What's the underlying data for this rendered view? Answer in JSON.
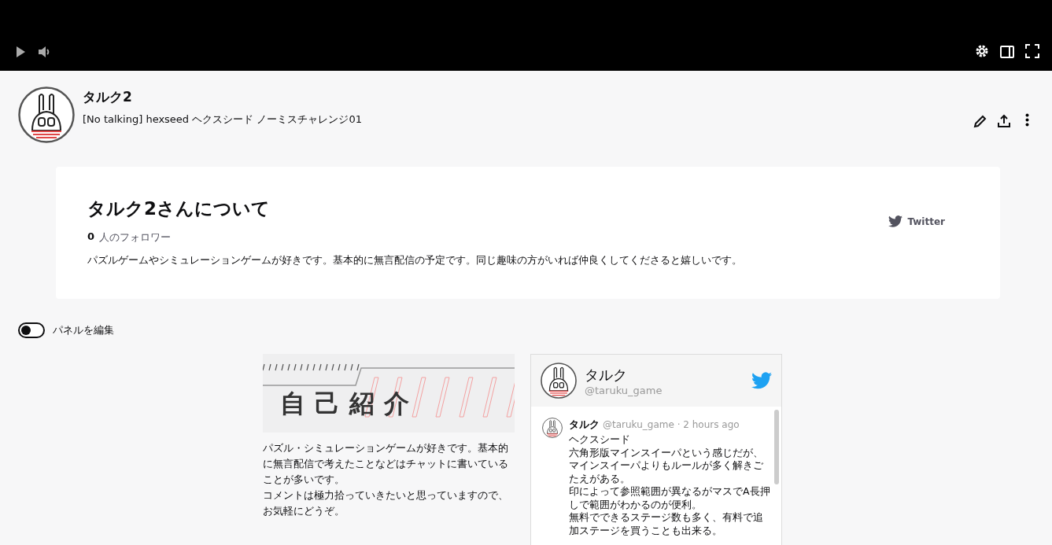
{
  "channel": {
    "name": "タルク2",
    "stream_title": "[No talking] hexseed ヘクスシード ノーミスチャレンジ01"
  },
  "about": {
    "title": "タルク2さんについて",
    "follower_count": "0",
    "follower_label": "人のフォロワー",
    "description": "パズルゲームやシミュレーションゲームが好きです。基本的に無言配信の予定です。同じ趣味の方がいれば仲良くしてくださると嬉しいです。",
    "social_link": "Twitter"
  },
  "edit_panels": {
    "label": "パネルを編集",
    "on": false
  },
  "panels": [
    {
      "kind": "text",
      "banner_title": "自己紹介",
      "body": [
        "パズル・シミュレーションゲームが好きです。基本的に無言配信で考えたことなどはチャットに書いていることが多いです。",
        "コメントは極力拾っていきたいと思っていますので、お気軽にどうぞ。"
      ]
    },
    {
      "kind": "twitter",
      "name": "タルク",
      "handle": "@taruku_game",
      "tweets": [
        {
          "name": "タルク",
          "meta": "@taruku_game · 2 hours ago",
          "text": [
            "ヘクスシード",
            "六角形版マインスイーパという感じだが、マインスイーパよりもルールが多く解きごたえがある。",
            "印によって参照範囲が異なるがマスでA長押しで範囲がわかるのが便利。",
            "無料でできるステージ数も多く、有料で追加ステージを買うことも出来る。"
          ]
        }
      ]
    }
  ]
}
